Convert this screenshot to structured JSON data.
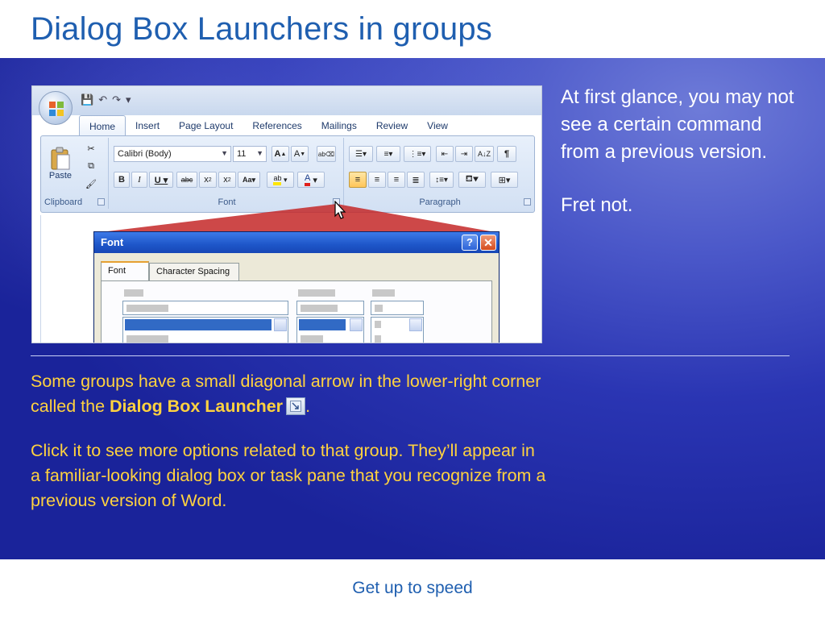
{
  "slide": {
    "title": "Dialog Box Launchers in groups",
    "footer": "Get up to speed"
  },
  "side_text": {
    "p1": "At first glance, you may not see a certain command from a previous version.",
    "p2": "Fret not."
  },
  "body_text": {
    "p1_before": "Some groups have a small diagonal arrow in the lower-right corner called the ",
    "p1_bold": "Dialog Box Launcher",
    "p1_after": ".",
    "p2": "Click it to see more options related to that group. They’ll appear in a familiar-looking dialog box or task pane that you recognize from a previous version of Word."
  },
  "screenshot": {
    "tabs": [
      "Home",
      "Insert",
      "Page Layout",
      "References",
      "Mailings",
      "Review",
      "View"
    ],
    "active_tab": "Home",
    "groups": {
      "clipboard": "Clipboard",
      "font": "Font",
      "paragraph": "Paragraph"
    },
    "paste_label": "Paste",
    "font_name": "Calibri (Body)",
    "font_size": "11",
    "dialog": {
      "title": "Font",
      "help": "?",
      "close": "✕",
      "tab_font": "Font",
      "tab_spacing": "Character Spacing"
    }
  },
  "colors": {
    "title": "#1f5fb0",
    "highlight_text": "#ffd23f",
    "stage_dark": "#1a239a",
    "stage_light": "#6e7bd8"
  },
  "icons": [
    "office-button-icon",
    "save-icon",
    "undo-icon",
    "redo-icon",
    "mouse-pointer-icon",
    "dialog-launcher-icon"
  ]
}
